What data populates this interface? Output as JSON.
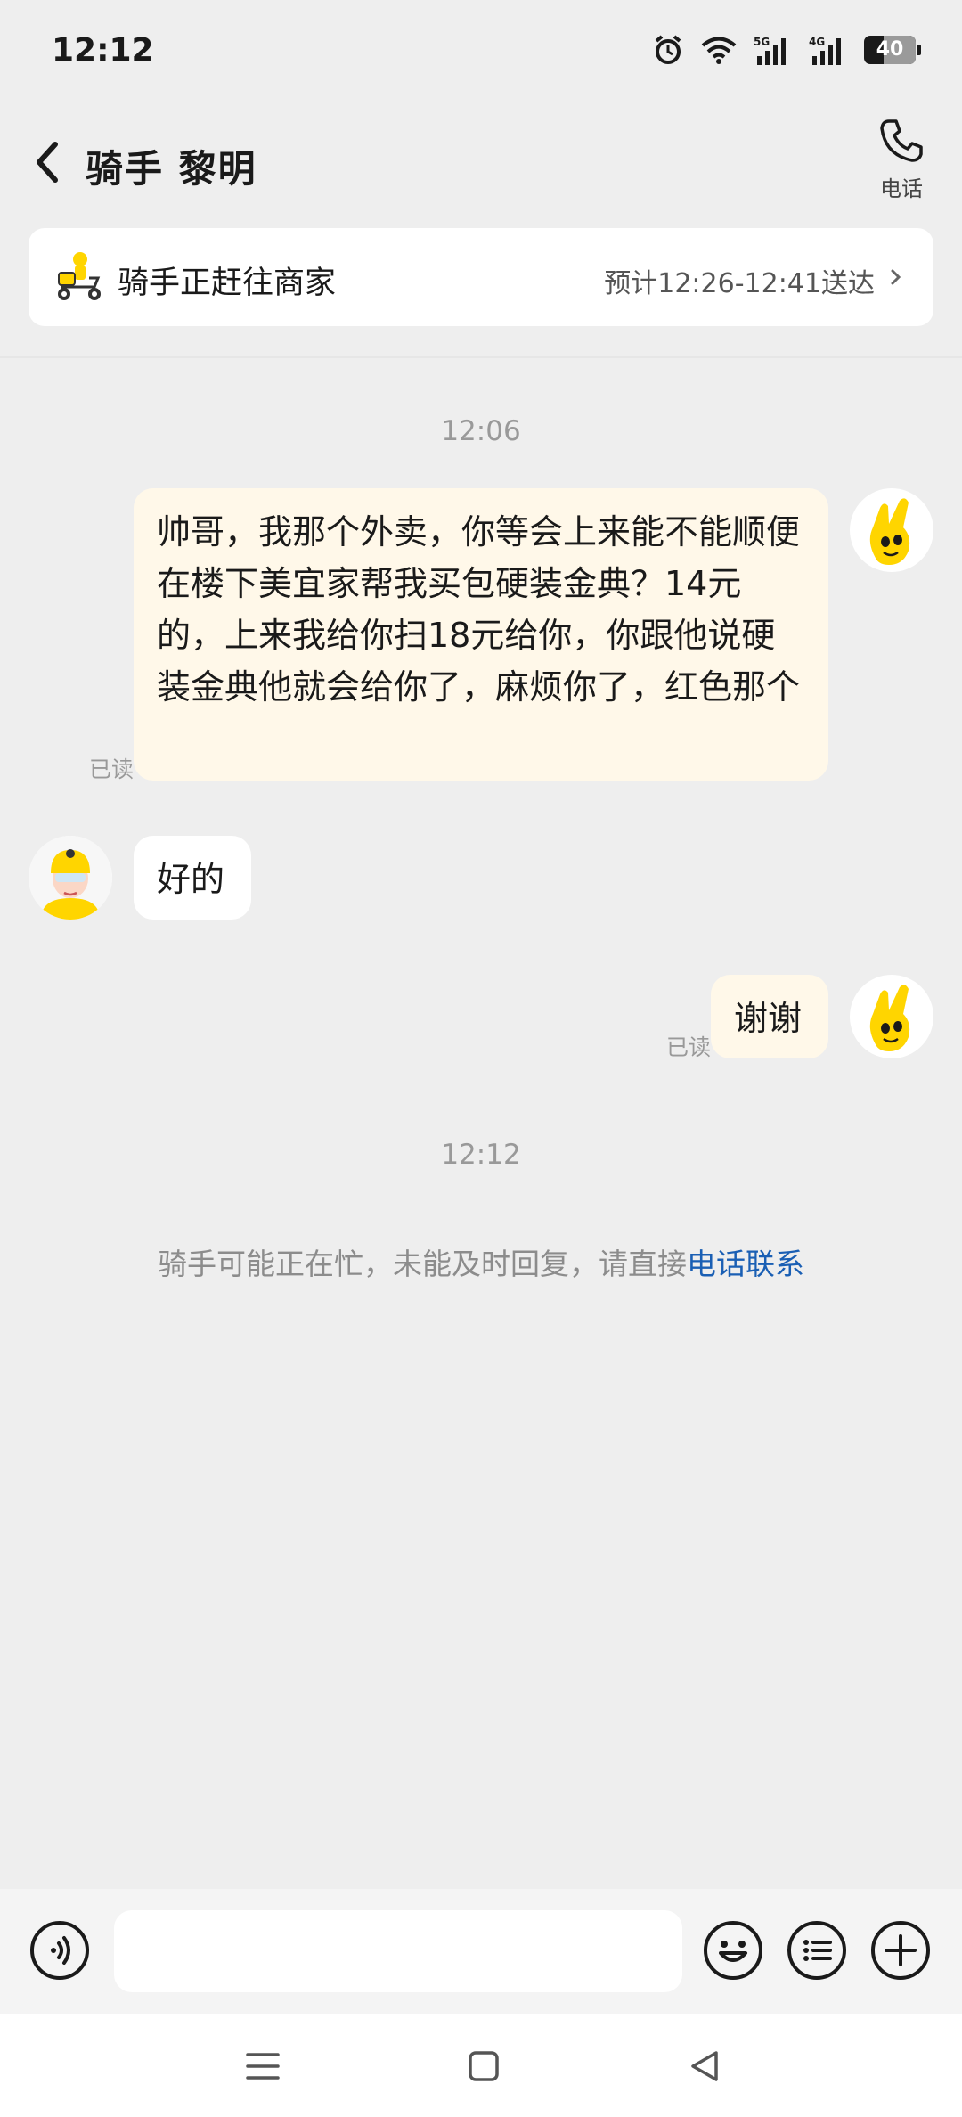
{
  "status_bar": {
    "time": "12:12",
    "battery": "40",
    "network_5g": "5G",
    "network_4g": "4G"
  },
  "header": {
    "title": "骑手 黎明",
    "call_label": "电话"
  },
  "delivery": {
    "status": "骑手正赶往商家",
    "eta": "预计12:26-12:41送达"
  },
  "chat": {
    "time1": "12:06",
    "msg1": "帅哥，我那个外卖，你等会上来能不能顺便在楼下美宜家帮我买包硬装金典？14元的，上来我给你扫18元给你，你跟他说硬装金典他就会给你了，麻烦你了，红色那个",
    "msg1_read": "已读",
    "msg2": "好的",
    "msg3": "谢谢",
    "msg3_read": "已读",
    "time2": "12:12",
    "notice_text": "骑手可能正在忙，未能及时回复，请直接",
    "notice_link": "电话联系"
  },
  "input": {
    "placeholder": ""
  },
  "colors": {
    "background": "#eeeeee",
    "outgoing_bubble": "#fff8e9",
    "incoming_bubble": "#ffffff",
    "link": "#1a5fb4",
    "avatar_yellow": "#ffd500"
  },
  "icons": [
    "back-chevron-icon",
    "phone-icon",
    "scooter-icon",
    "chevron-right-icon",
    "voice-icon",
    "emoji-icon",
    "list-icon",
    "plus-icon",
    "menu-icon",
    "home-square-icon",
    "back-triangle-icon",
    "alarm-icon",
    "wifi-icon",
    "signal-icon",
    "battery-icon"
  ]
}
